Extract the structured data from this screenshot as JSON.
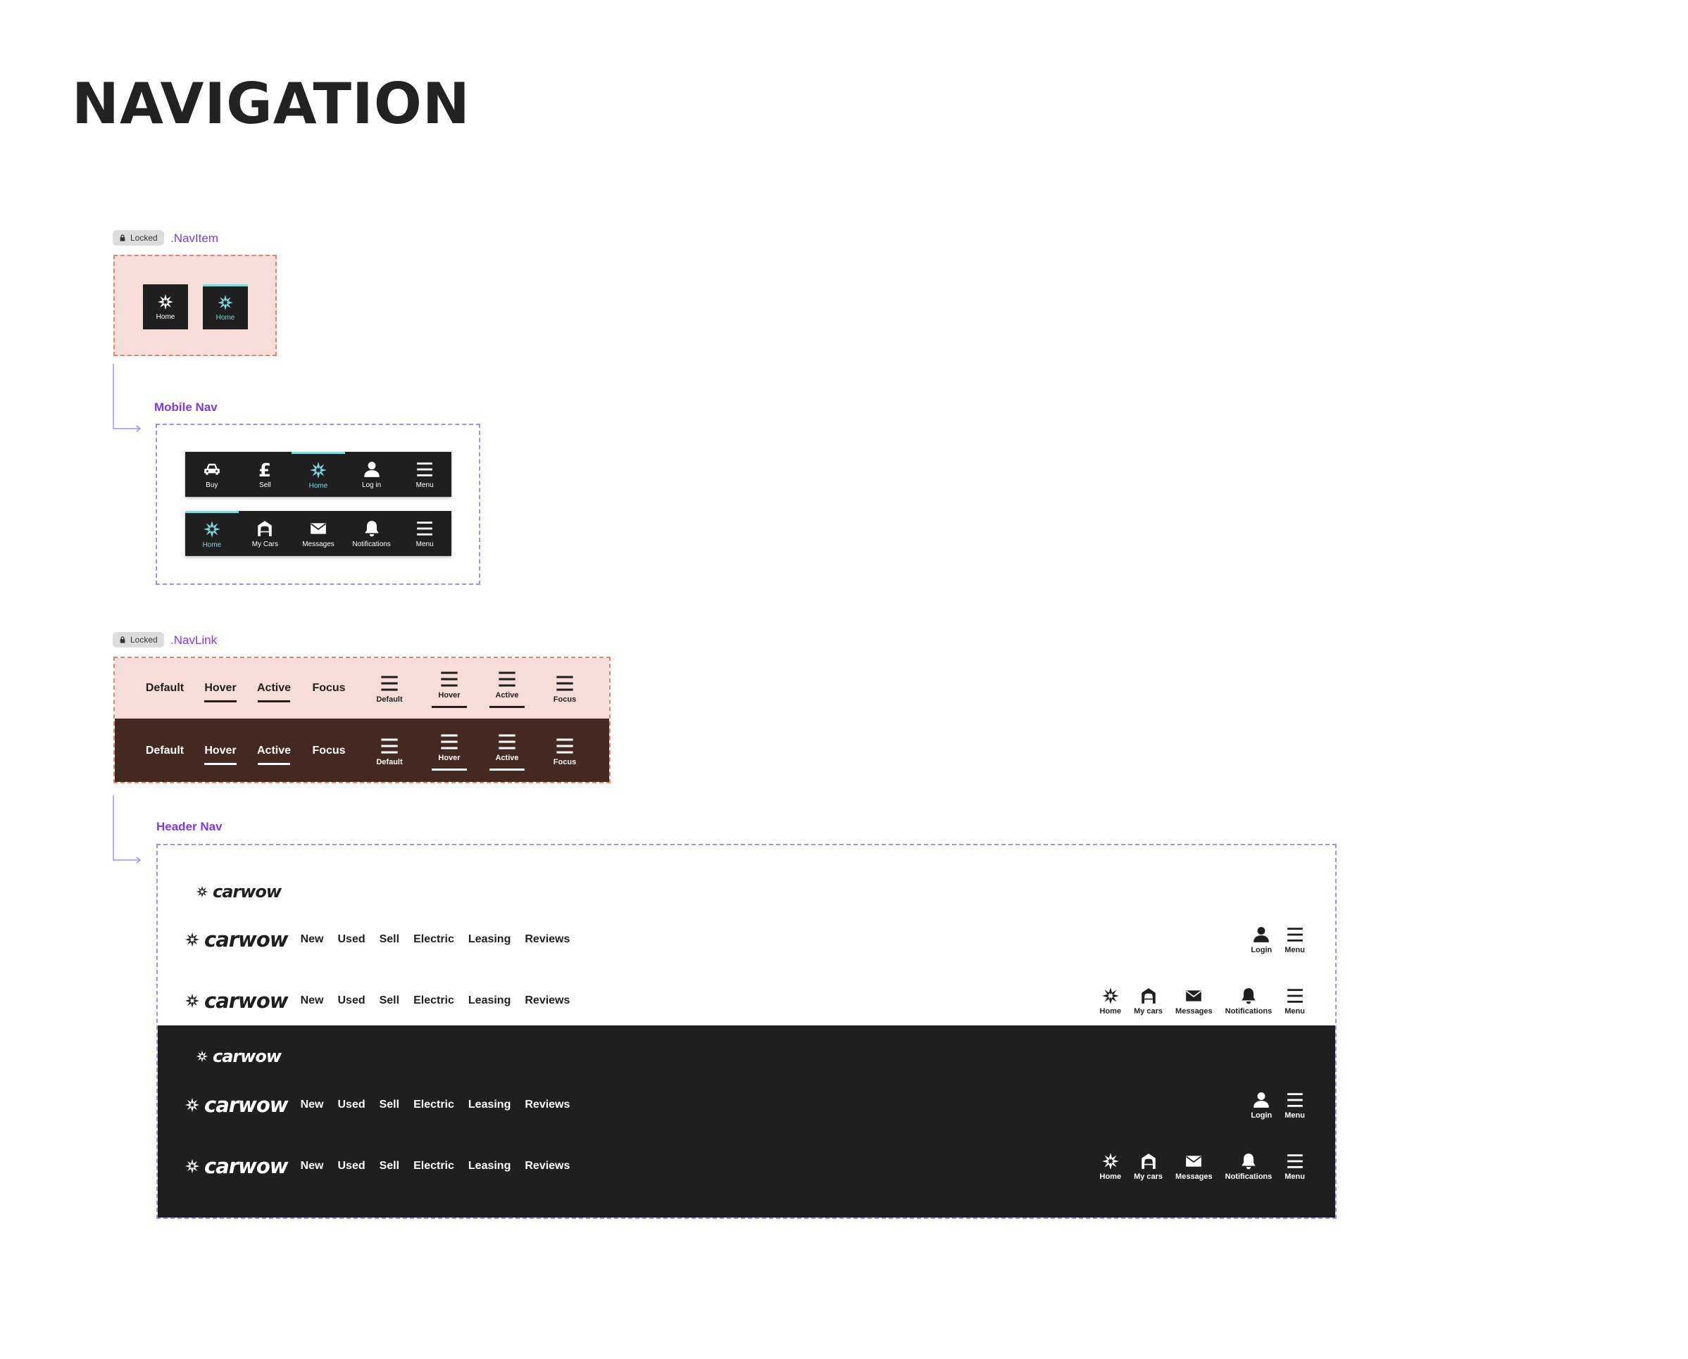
{
  "page": {
    "title": "NAVIGATION"
  },
  "colors": {
    "accent": "#7fd8e0",
    "purple": "#7c3aed",
    "dark": "#1f1f1f",
    "brown": "#43291f",
    "pink": "#f6ddd7"
  },
  "navitem": {
    "badge": "Locked",
    "name": ".NavItem",
    "items": [
      {
        "label": "Home",
        "icon": "carwow-star-icon",
        "state": "default"
      },
      {
        "label": "Home",
        "icon": "carwow-star-icon",
        "state": "active"
      }
    ]
  },
  "mobile_nav": {
    "label": "Mobile Nav",
    "bar1": [
      {
        "label": "Buy",
        "icon": "car-icon"
      },
      {
        "label": "Sell",
        "icon": "pound-icon"
      },
      {
        "label": "Home",
        "icon": "carwow-star-icon",
        "active": true
      },
      {
        "label": "Log in",
        "icon": "user-icon"
      },
      {
        "label": "Menu",
        "icon": "hamburger-icon"
      }
    ],
    "bar2": [
      {
        "label": "Home",
        "icon": "carwow-star-icon",
        "active": true
      },
      {
        "label": "My Cars",
        "icon": "garage-icon"
      },
      {
        "label": "Messages",
        "icon": "envelope-icon"
      },
      {
        "label": "Notifications",
        "icon": "bell-icon"
      },
      {
        "label": "Menu",
        "icon": "hamburger-icon"
      }
    ]
  },
  "navlink": {
    "badge": "Locked",
    "name": ".NavLink",
    "text_states": [
      "Default",
      "Hover",
      "Active",
      "Focus"
    ],
    "menu_states": [
      "Default",
      "Hover",
      "Active",
      "Focus"
    ]
  },
  "header_nav": {
    "label": "Header Nav",
    "logo_text": "carwow",
    "links": [
      "New",
      "Used",
      "Sell",
      "Electric",
      "Leasing",
      "Reviews"
    ],
    "guest_icons": [
      {
        "label": "Login",
        "icon": "user-icon"
      },
      {
        "label": "Menu",
        "icon": "hamburger-icon"
      }
    ],
    "user_icons": [
      {
        "label": "Home",
        "icon": "carwow-star-icon"
      },
      {
        "label": "My cars",
        "icon": "garage-icon"
      },
      {
        "label": "Messages",
        "icon": "envelope-icon"
      },
      {
        "label": "Notifications",
        "icon": "bell-icon"
      },
      {
        "label": "Menu",
        "icon": "hamburger-icon"
      }
    ]
  }
}
